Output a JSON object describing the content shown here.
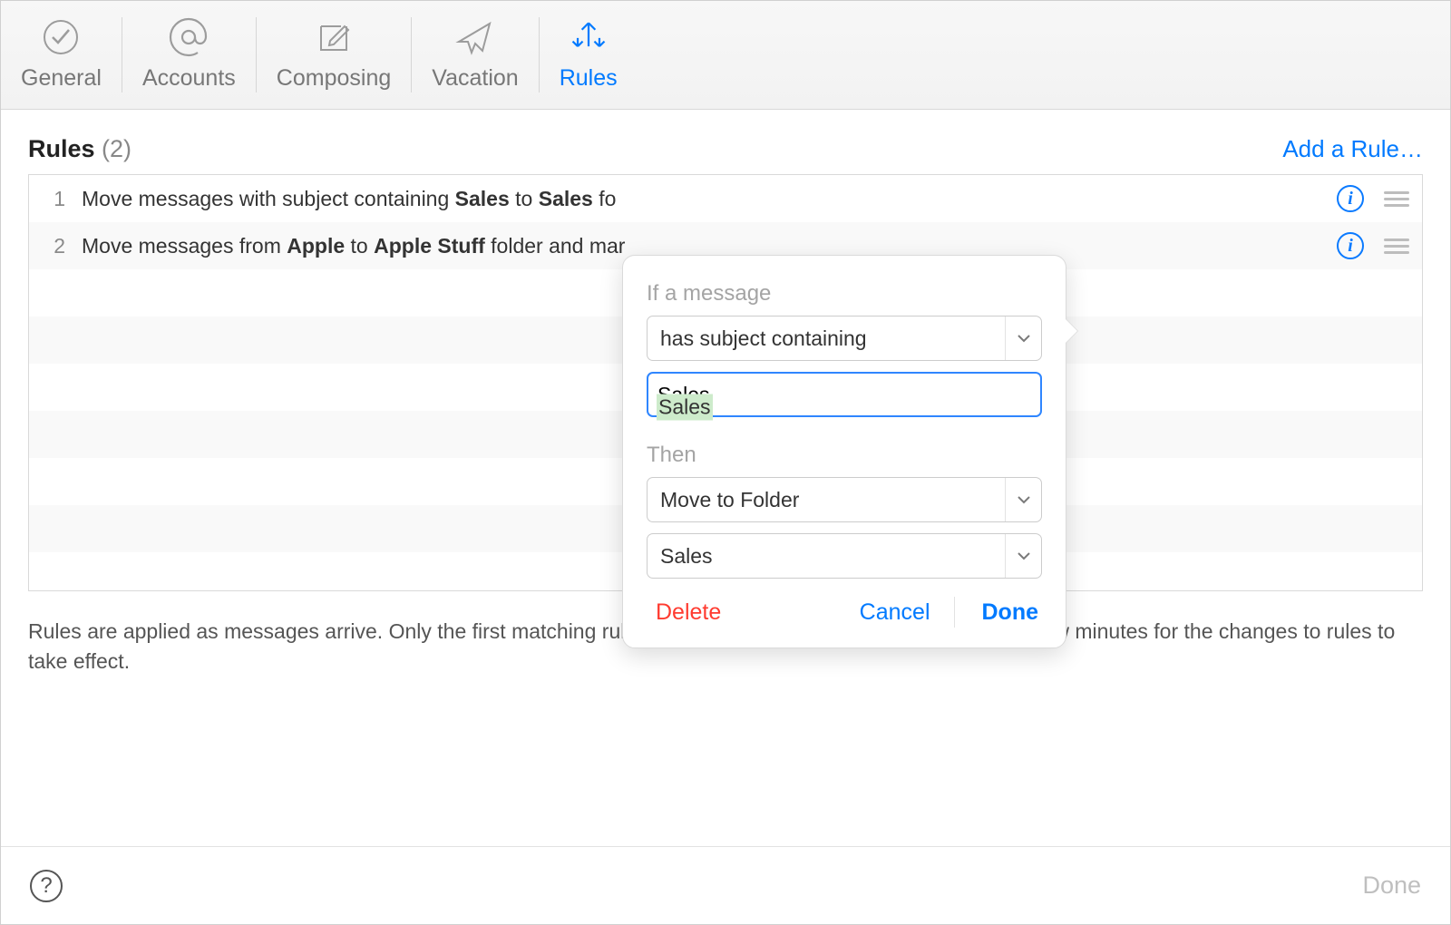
{
  "colors": {
    "accent": "#007aff",
    "danger": "#ff3b30"
  },
  "toolbar": {
    "tabs": [
      {
        "id": "general",
        "label": "General",
        "active": false
      },
      {
        "id": "accounts",
        "label": "Accounts",
        "active": false
      },
      {
        "id": "composing",
        "label": "Composing",
        "active": false
      },
      {
        "id": "vacation",
        "label": "Vacation",
        "active": false
      },
      {
        "id": "rules",
        "label": "Rules",
        "active": true
      }
    ]
  },
  "rules": {
    "title": "Rules",
    "count_label": "(2)",
    "add_label": "Add a Rule…",
    "rows": [
      {
        "index": "1",
        "text_parts": [
          "Move messages with subject containing ",
          "Sales",
          " to ",
          "Sales",
          " fo"
        ]
      },
      {
        "index": "2",
        "text_parts": [
          "Move messages from ",
          "Apple",
          " to ",
          "Apple Stuff",
          " folder and mar"
        ]
      }
    ],
    "hint": "Rules are applied as messages arrive. Only the first matching rule will be applied per message. It may take a few minutes for the changes to rules to take effect."
  },
  "popover": {
    "if_label": "If a message",
    "condition_select": "has subject containing",
    "condition_value": "Sales",
    "then_label": "Then",
    "action_select": "Move to Folder",
    "folder_select": "Sales",
    "buttons": {
      "delete": "Delete",
      "cancel": "Cancel",
      "done": "Done"
    }
  },
  "footer": {
    "done": "Done"
  }
}
